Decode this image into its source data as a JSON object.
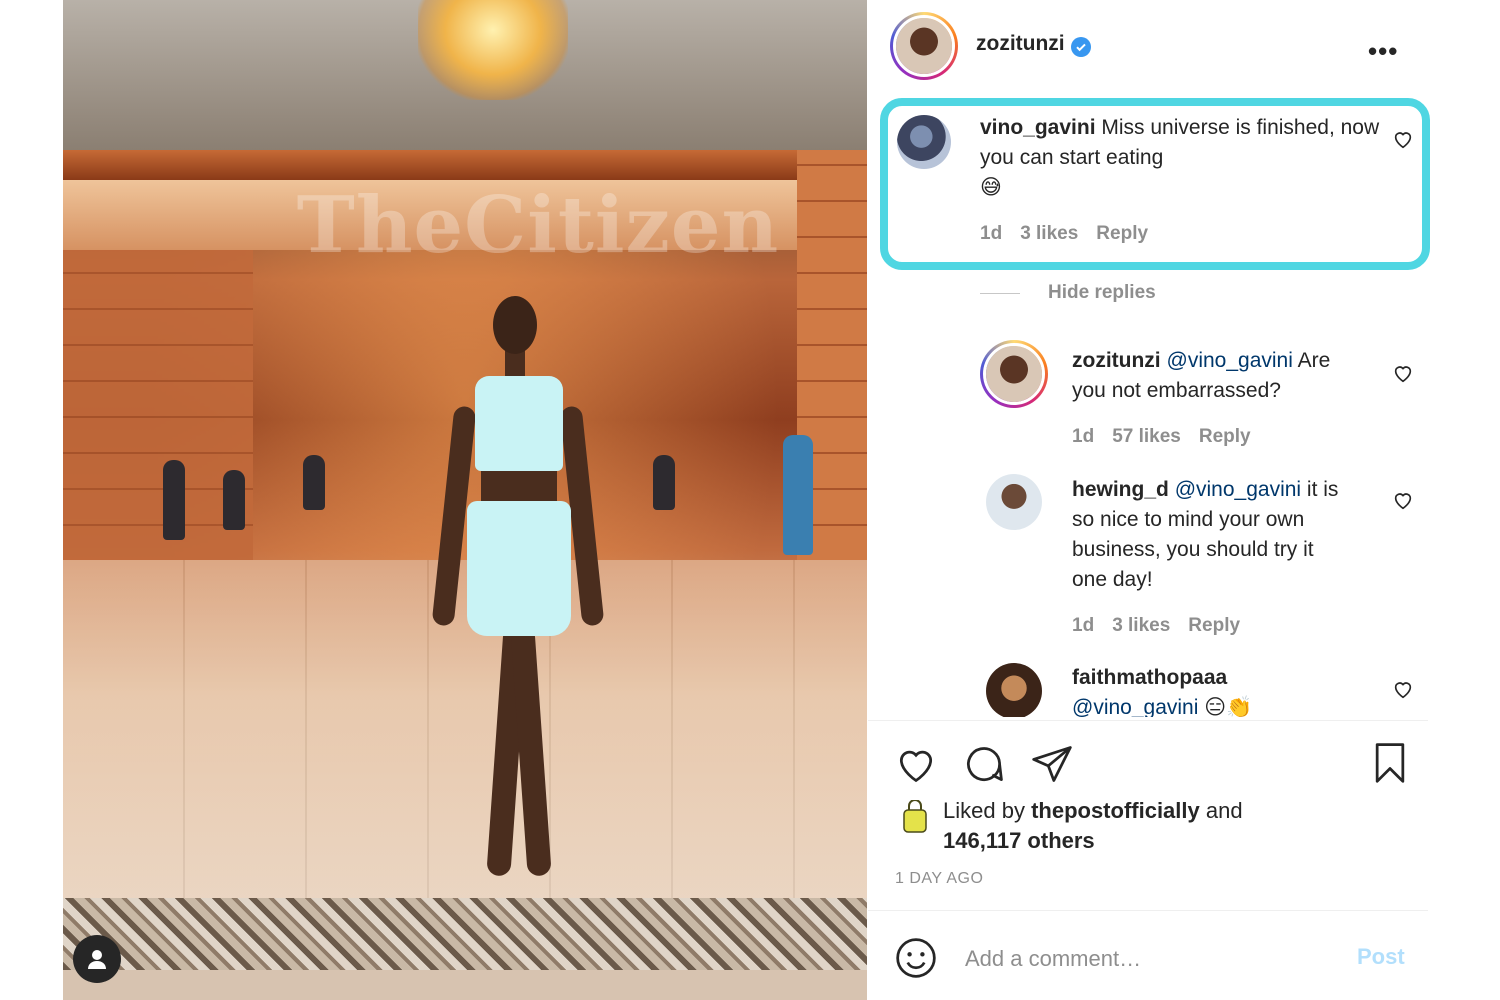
{
  "photo": {
    "watermark": "TheCitizen",
    "user_tag_icon": "person-icon"
  },
  "post": {
    "author": "zozitunzi",
    "verified_icon": "verified-badge-icon",
    "more_icon": "more-options-icon",
    "more_label": "•••"
  },
  "comments": [
    {
      "user": "vino_gavini",
      "text": "Miss universe is finished, now you can start eating",
      "emoji": "😅",
      "age": "1d",
      "likes": "3 likes",
      "reply": "Reply",
      "highlighted": true
    }
  ],
  "hide_replies": "Hide replies",
  "replies": [
    {
      "user": "zozitunzi",
      "mention": "@vino_gavini",
      "text_line1": " Are",
      "text_rest": "you not embarrassed?",
      "age": "1d",
      "likes": "57 likes",
      "reply": "Reply"
    },
    {
      "user": "hewing_d",
      "mention": "@vino_gavini",
      "text_line1": " it is",
      "text_rest_lines": [
        "so nice to mind your own",
        "business, you should try it",
        "one day!"
      ],
      "age": "1d",
      "likes": "3 likes",
      "reply": "Reply"
    },
    {
      "user": "faithmathopaaa",
      "mention": "@vino_gavini",
      "emoji": "😑👏"
    }
  ],
  "likes": {
    "prefix": "Liked by ",
    "user": "thepostofficially",
    "middle": " and",
    "count": "146,117 others"
  },
  "timestamp": "1 DAY AGO",
  "add_comment": {
    "placeholder": "Add a comment…",
    "post_label": "Post"
  },
  "colors": {
    "highlight": "#4fd6e2",
    "verified": "#3897f0",
    "post_button": "#b2dffc",
    "meta_gray": "#8e8e8e",
    "mention": "#00376b"
  }
}
